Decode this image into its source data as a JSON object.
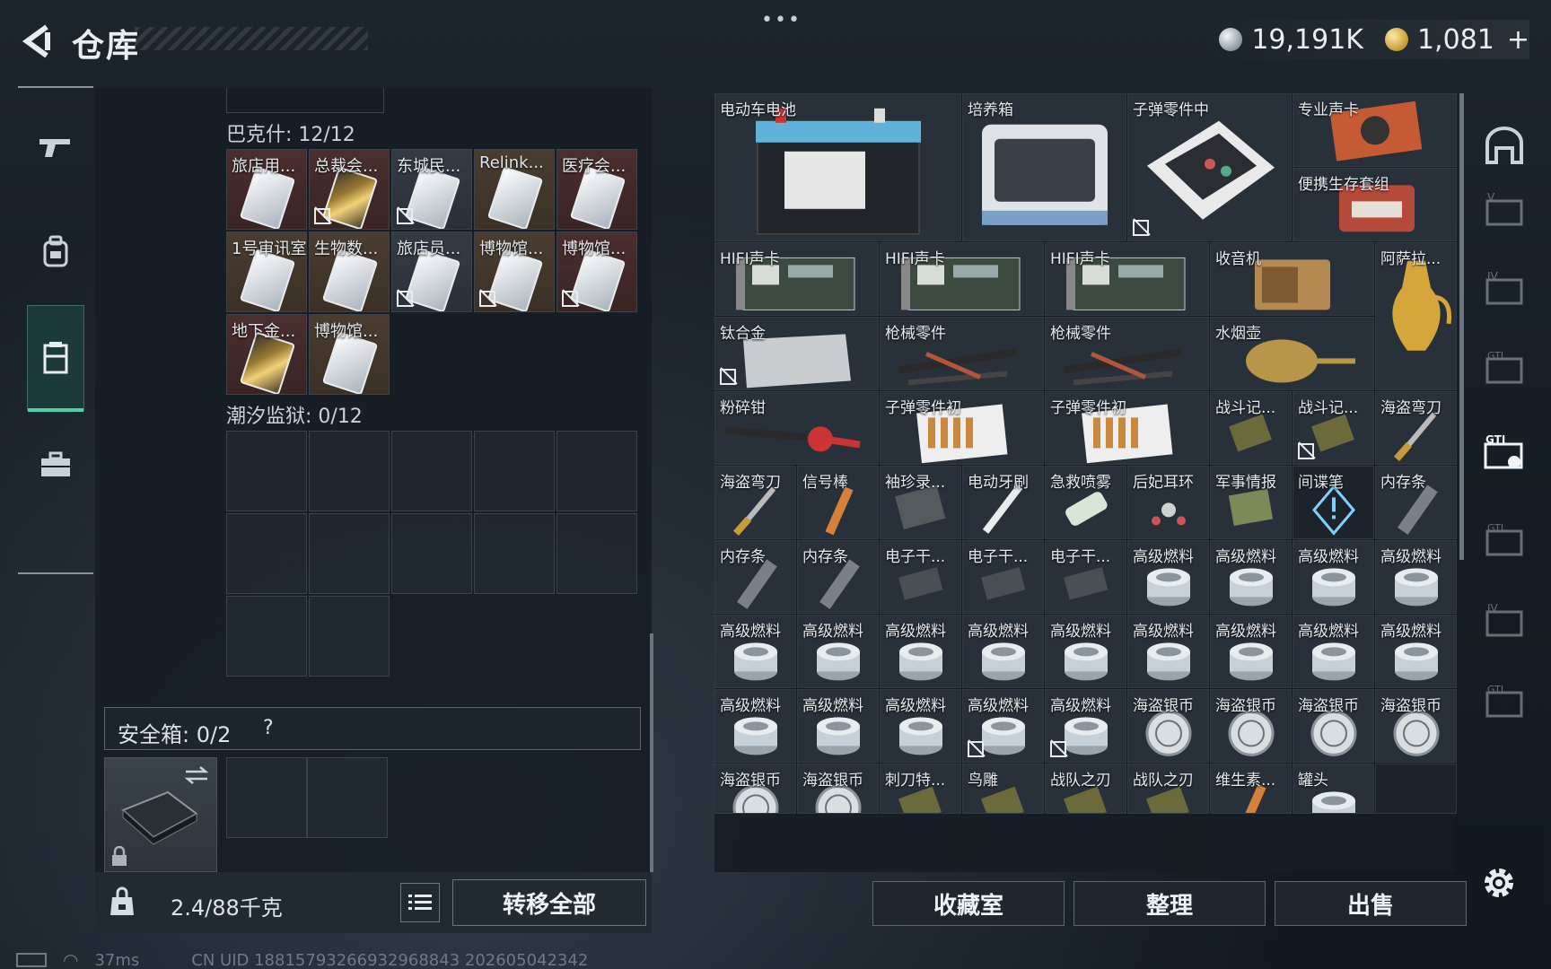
{
  "header": {
    "title": "仓库",
    "menu": "•••"
  },
  "currency": {
    "silver": "19,191K",
    "gold": "1,081",
    "gold_add": "+"
  },
  "left": {
    "section1_label": "巴克什: 12/12",
    "section1_items": [
      {
        "name": "旅店用...",
        "style": "red",
        "card": "white",
        "flag": false
      },
      {
        "name": "总裁会...",
        "style": "red",
        "card": "gold",
        "flag": true
      },
      {
        "name": "东城民...",
        "style": "slate",
        "card": "white",
        "flag": true
      },
      {
        "name": "Relink...",
        "style": "brown",
        "card": "white",
        "flag": false
      },
      {
        "name": "医疗会...",
        "style": "red",
        "card": "white",
        "flag": false
      },
      {
        "name": "1号审讯室",
        "style": "brown",
        "card": "white",
        "flag": false
      },
      {
        "name": "生物数...",
        "style": "brown",
        "card": "white",
        "flag": false
      },
      {
        "name": "旅店员...",
        "style": "slate",
        "card": "white",
        "flag": true
      },
      {
        "name": "博物馆...",
        "style": "brown",
        "card": "white",
        "flag": true
      },
      {
        "name": "博物馆...",
        "style": "red",
        "card": "white",
        "flag": true
      },
      {
        "name": "地下金...",
        "style": "red",
        "card": "gold",
        "flag": false
      },
      {
        "name": "博物馆...",
        "style": "brown",
        "card": "white",
        "flag": false
      }
    ],
    "section2_label": "潮汐监狱: 0/12",
    "safe_label": "安全箱: 0/2",
    "safe_help": "?",
    "weight": "2.4/88千克",
    "transfer_all": "转移全部"
  },
  "right": {
    "items": [
      {
        "name": "电动车电池",
        "col": 0,
        "row": 0,
        "w": 3,
        "h": 2,
        "pic": "battery"
      },
      {
        "name": "培养箱",
        "col": 3,
        "row": 0,
        "w": 2,
        "h": 2,
        "pic": "incubator"
      },
      {
        "name": "子弹零件中",
        "col": 5,
        "row": 0,
        "w": 2,
        "h": 2,
        "pic": "bulletbox",
        "flag": true
      },
      {
        "name": "专业声卡",
        "col": 7,
        "row": 0,
        "w": 2,
        "h": 1,
        "pic": "soundcard"
      },
      {
        "name": "便携生存套组",
        "col": 7,
        "row": 1,
        "w": 2,
        "h": 1,
        "pic": "kit"
      },
      {
        "name": "HIFI声卡",
        "col": 0,
        "row": 2,
        "w": 2,
        "h": 1,
        "pic": "pcb"
      },
      {
        "name": "HIFI声卡",
        "col": 2,
        "row": 2,
        "w": 2,
        "h": 1,
        "pic": "pcb"
      },
      {
        "name": "HIFI声卡",
        "col": 4,
        "row": 2,
        "w": 2,
        "h": 1,
        "pic": "pcb"
      },
      {
        "name": "收音机",
        "col": 6,
        "row": 2,
        "w": 2,
        "h": 1,
        "pic": "radio"
      },
      {
        "name": "阿萨拉...",
        "col": 8,
        "row": 2,
        "w": 1,
        "h": 2,
        "pic": "jug"
      },
      {
        "name": "钛合金",
        "col": 0,
        "row": 3,
        "w": 2,
        "h": 1,
        "pic": "plate",
        "flag": true
      },
      {
        "name": "枪械零件",
        "col": 2,
        "row": 3,
        "w": 2,
        "h": 1,
        "pic": "gunparts"
      },
      {
        "name": "枪械零件",
        "col": 4,
        "row": 3,
        "w": 2,
        "h": 1,
        "pic": "gunparts"
      },
      {
        "name": "水烟壶",
        "col": 6,
        "row": 3,
        "w": 2,
        "h": 1,
        "pic": "hookah"
      },
      {
        "name": "粉碎钳",
        "col": 0,
        "row": 4,
        "w": 2,
        "h": 1,
        "pic": "cutter"
      },
      {
        "name": "子弹零件初",
        "col": 2,
        "row": 4,
        "w": 2,
        "h": 1,
        "pic": "bullets"
      },
      {
        "name": "子弹零件初",
        "col": 4,
        "row": 4,
        "w": 2,
        "h": 1,
        "pic": "bullets"
      },
      {
        "name": "战斗记...",
        "col": 6,
        "row": 4,
        "w": 1,
        "h": 1,
        "pic": "chip"
      },
      {
        "name": "战斗记...",
        "col": 7,
        "row": 4,
        "w": 1,
        "h": 1,
        "pic": "chip",
        "flag": true
      },
      {
        "name": "海盗弯刀",
        "col": 8,
        "row": 4,
        "w": 1,
        "h": 1,
        "pic": "knife"
      },
      {
        "name": "海盗弯刀",
        "col": 0,
        "row": 5,
        "w": 1,
        "h": 1,
        "pic": "knife"
      },
      {
        "name": "信号棒",
        "col": 1,
        "row": 5,
        "w": 1,
        "h": 1,
        "pic": "flare"
      },
      {
        "name": "袖珍录...",
        "col": 2,
        "row": 5,
        "w": 1,
        "h": 1,
        "pic": "recorder"
      },
      {
        "name": "电动牙刷",
        "col": 3,
        "row": 5,
        "w": 1,
        "h": 1,
        "pic": "toothbrush"
      },
      {
        "name": "急救喷雾",
        "col": 4,
        "row": 5,
        "w": 1,
        "h": 1,
        "pic": "spray"
      },
      {
        "name": "后妃耳环",
        "col": 5,
        "row": 5,
        "w": 1,
        "h": 1,
        "pic": "earring"
      },
      {
        "name": "军事情报",
        "col": 6,
        "row": 5,
        "w": 1,
        "h": 1,
        "pic": "board"
      },
      {
        "name": "间谍笔",
        "col": 7,
        "row": 5,
        "w": 1,
        "h": 1,
        "pic": "warn",
        "dark": true
      },
      {
        "name": "内存条",
        "col": 8,
        "row": 5,
        "w": 1,
        "h": 1,
        "pic": "ram"
      },
      {
        "name": "内存条",
        "col": 0,
        "row": 6,
        "w": 1,
        "h": 1,
        "pic": "ram"
      },
      {
        "name": "内存条",
        "col": 1,
        "row": 6,
        "w": 1,
        "h": 1,
        "pic": "ram"
      },
      {
        "name": "电子干...",
        "col": 2,
        "row": 6,
        "w": 1,
        "h": 1,
        "pic": "device"
      },
      {
        "name": "电子干...",
        "col": 3,
        "row": 6,
        "w": 1,
        "h": 1,
        "pic": "device"
      },
      {
        "name": "电子干...",
        "col": 4,
        "row": 6,
        "w": 1,
        "h": 1,
        "pic": "device"
      },
      {
        "name": "高级燃料",
        "col": 5,
        "row": 6,
        "w": 1,
        "h": 1,
        "pic": "can"
      },
      {
        "name": "高级燃料",
        "col": 6,
        "row": 6,
        "w": 1,
        "h": 1,
        "pic": "can"
      },
      {
        "name": "高级燃料",
        "col": 7,
        "row": 6,
        "w": 1,
        "h": 1,
        "pic": "can"
      },
      {
        "name": "高级燃料",
        "col": 8,
        "row": 6,
        "w": 1,
        "h": 1,
        "pic": "can"
      },
      {
        "name": "高级燃料",
        "col": 0,
        "row": 7,
        "w": 1,
        "h": 1,
        "pic": "can"
      },
      {
        "name": "高级燃料",
        "col": 1,
        "row": 7,
        "w": 1,
        "h": 1,
        "pic": "can"
      },
      {
        "name": "高级燃料",
        "col": 2,
        "row": 7,
        "w": 1,
        "h": 1,
        "pic": "can"
      },
      {
        "name": "高级燃料",
        "col": 3,
        "row": 7,
        "w": 1,
        "h": 1,
        "pic": "can"
      },
      {
        "name": "高级燃料",
        "col": 4,
        "row": 7,
        "w": 1,
        "h": 1,
        "pic": "can"
      },
      {
        "name": "高级燃料",
        "col": 5,
        "row": 7,
        "w": 1,
        "h": 1,
        "pic": "can"
      },
      {
        "name": "高级燃料",
        "col": 6,
        "row": 7,
        "w": 1,
        "h": 1,
        "pic": "can"
      },
      {
        "name": "高级燃料",
        "col": 7,
        "row": 7,
        "w": 1,
        "h": 1,
        "pic": "can"
      },
      {
        "name": "高级燃料",
        "col": 8,
        "row": 7,
        "w": 1,
        "h": 1,
        "pic": "can"
      },
      {
        "name": "高级燃料",
        "col": 0,
        "row": 8,
        "w": 1,
        "h": 1,
        "pic": "can"
      },
      {
        "name": "高级燃料",
        "col": 1,
        "row": 8,
        "w": 1,
        "h": 1,
        "pic": "can"
      },
      {
        "name": "高级燃料",
        "col": 2,
        "row": 8,
        "w": 1,
        "h": 1,
        "pic": "can"
      },
      {
        "name": "高级燃料",
        "col": 3,
        "row": 8,
        "w": 1,
        "h": 1,
        "pic": "can",
        "flag": true
      },
      {
        "name": "高级燃料",
        "col": 4,
        "row": 8,
        "w": 1,
        "h": 1,
        "pic": "can",
        "flag": true
      },
      {
        "name": "海盗银币",
        "col": 5,
        "row": 8,
        "w": 1,
        "h": 1,
        "pic": "coin"
      },
      {
        "name": "海盗银币",
        "col": 6,
        "row": 8,
        "w": 1,
        "h": 1,
        "pic": "coin"
      },
      {
        "name": "海盗银币",
        "col": 7,
        "row": 8,
        "w": 1,
        "h": 1,
        "pic": "coin"
      },
      {
        "name": "海盗银币",
        "col": 8,
        "row": 8,
        "w": 1,
        "h": 1,
        "pic": "coin"
      },
      {
        "name": "海盗银币",
        "col": 0,
        "row": 9,
        "w": 1,
        "h": 1,
        "pic": "coin"
      },
      {
        "name": "海盗银币",
        "col": 1,
        "row": 9,
        "w": 1,
        "h": 1,
        "pic": "coin"
      },
      {
        "name": "刺刀特...",
        "col": 2,
        "row": 9,
        "w": 1,
        "h": 1,
        "pic": "chip"
      },
      {
        "name": "鸟雕",
        "col": 3,
        "row": 9,
        "w": 1,
        "h": 1,
        "pic": "chip"
      },
      {
        "name": "战队之刃",
        "col": 4,
        "row": 9,
        "w": 1,
        "h": 1,
        "pic": "chip"
      },
      {
        "name": "战队之刃",
        "col": 5,
        "row": 9,
        "w": 1,
        "h": 1,
        "pic": "chip"
      },
      {
        "name": "维生素...",
        "col": 6,
        "row": 9,
        "w": 1,
        "h": 1,
        "pic": "flare"
      },
      {
        "name": "罐头",
        "col": 7,
        "row": 9,
        "w": 1,
        "h": 1,
        "pic": "can"
      }
    ],
    "buttons": {
      "collection": "收藏室",
      "sort": "整理",
      "sell": "出售"
    }
  },
  "status": {
    "ping": "37ms",
    "uid": "CN UID 18815793266932968843 202605042342"
  },
  "colors": {
    "accent_green": "#4fd1a3",
    "panel": "#161d24"
  }
}
